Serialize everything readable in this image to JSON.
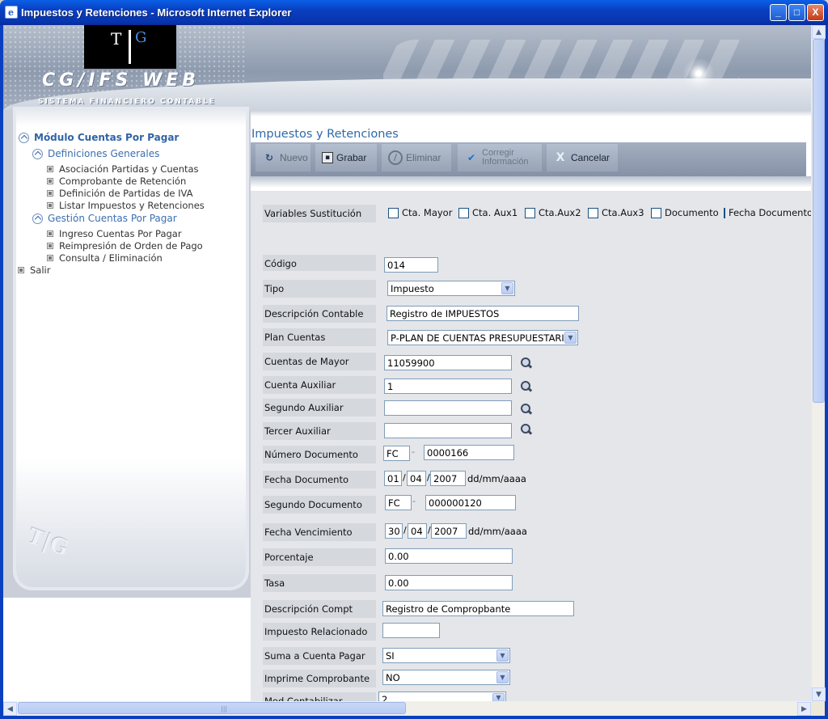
{
  "window": {
    "title": "Impuestos y Retenciones - Microsoft Internet Explorer",
    "minimize": "_",
    "maximize": "□",
    "close": "X"
  },
  "banner": {
    "logo_left": "T",
    "logo_right": "G",
    "brand": "CG/IFS WEB",
    "subtitle": "SISTEMA FINANCIERO CONTABLE"
  },
  "nav": {
    "module": "Módulo Cuentas Por Pagar",
    "sections": [
      {
        "label": "Definiciones Generales",
        "items": [
          "Asociación Partidas y Cuentas",
          "Comprobante de Retención",
          "Definición de Partidas de IVA",
          "Listar Impuestos y Retenciones"
        ]
      },
      {
        "label": "Gestión Cuentas Por Pagar",
        "items": [
          "Ingreso Cuentas Por Pagar",
          "Reimpresión de Orden de Pago",
          "Consulta / Eliminación"
        ]
      }
    ],
    "exit": "Salir"
  },
  "page": {
    "title": "Impuestos y Retenciones"
  },
  "toolbar": {
    "nuevo": "Nuevo",
    "grabar": "Grabar",
    "eliminar": "Eliminar",
    "corregir1": "Corregir",
    "corregir2": "Información",
    "cancelar": "Cancelar"
  },
  "form": {
    "vars_label": "Variables Sustitución",
    "vars": [
      "Cta. Mayor",
      "Cta. Aux1",
      "Cta.Aux2",
      "Cta.Aux3",
      "Documento",
      "Fecha Documento"
    ],
    "codigo_label": "Código",
    "codigo": "014",
    "tipo_label": "Tipo",
    "tipo": "Impuesto",
    "desc_label": "Descripción Contable",
    "desc": "Registro de IMPUESTOS",
    "plan_label": "Plan Cuentas",
    "plan": "P-PLAN DE CUENTAS PRESUPUESTARIO",
    "mayor_label": "Cuentas de Mayor",
    "mayor": "11059900",
    "aux_label": "Cuenta Auxiliar",
    "aux": "1",
    "aux2_label": "Segundo Auxiliar",
    "aux2": "",
    "aux3_label": "Tercer Auxiliar",
    "aux3": "",
    "numdoc_label": "Número Documento",
    "numdoc_pre": "FC",
    "numdoc": "0000166",
    "fecha_label": "Fecha Documento",
    "fecha_d": "01",
    "fecha_m": "04",
    "fecha_y": "2007",
    "fecha_fmt": "dd/mm/aaaa",
    "segdoc_label": "Segundo Documento",
    "segdoc_pre": "FC",
    "segdoc": "000000120",
    "venc_label": "Fecha Vencimiento",
    "venc_d": "30",
    "venc_m": "04",
    "venc_y": "2007",
    "venc_fmt": "dd/mm/aaaa",
    "porc_label": "Porcentaje",
    "porc": "0.00",
    "tasa_label": "Tasa",
    "tasa": "0.00",
    "dcompt_label": "Descripción Compt",
    "dcompt": "Registro de Compropbante",
    "imprel_label": "Impuesto Relacionado",
    "imprel": "",
    "suma_label": "Suma a Cuenta Pagar",
    "suma": "SI",
    "impr_label": "Imprime Comprobante",
    "impr": "NO",
    "modc_label": "Mod.Contabilizar",
    "modc": "2",
    "date_sep": "/",
    "dash": "-"
  },
  "scroll": {
    "up": "▲",
    "down": "▼",
    "left": "◀",
    "right": "▶",
    "grip": "|||"
  }
}
